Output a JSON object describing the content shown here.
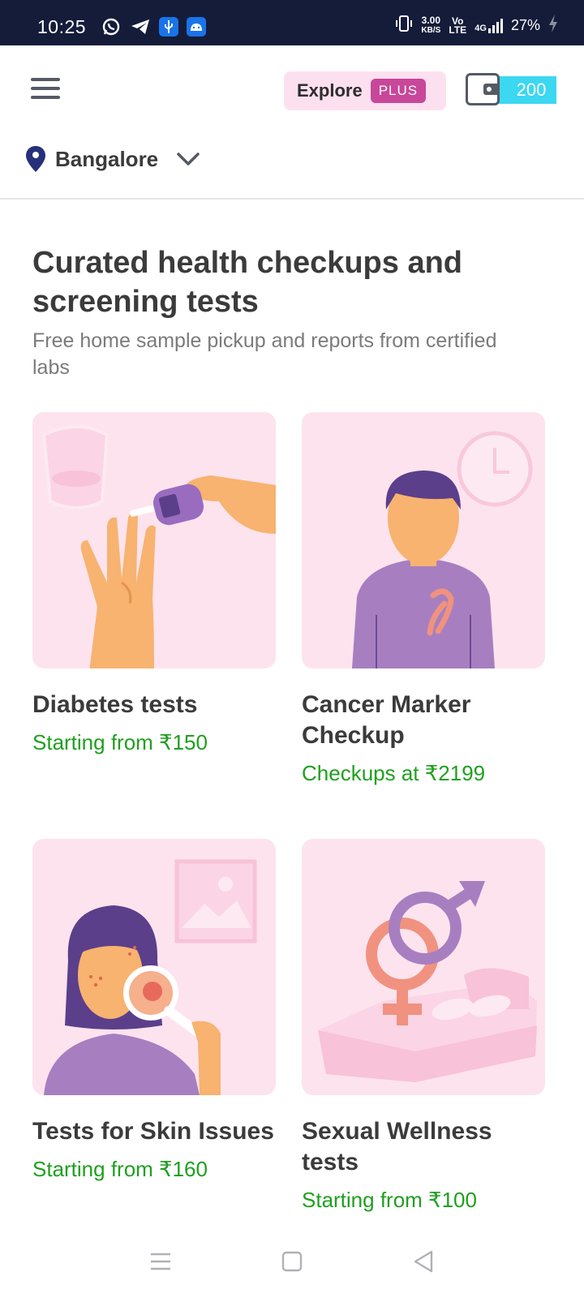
{
  "status_bar": {
    "time": "10:25",
    "net_speed_value": "3.00",
    "net_speed_unit": "KB/S",
    "volte": "Vo LTE",
    "network": "4G",
    "battery": "27%"
  },
  "header": {
    "explore_label": "Explore",
    "plus_badge": "PLUS",
    "wallet_balance": "200",
    "location": "Bangalore"
  },
  "main": {
    "title": "Curated health checkups and screening tests",
    "subtitle": "Free home sample pickup and reports from certified labs",
    "cards": [
      {
        "title": "Diabetes tests",
        "price": "Starting from ₹150"
      },
      {
        "title": "Cancer Marker Checkup",
        "price": "Checkups at ₹2199"
      },
      {
        "title": "Tests for Skin Issues",
        "price": "Starting from ₹160"
      },
      {
        "title": "Sexual Wellness tests",
        "price": "Starting from ₹100"
      }
    ]
  },
  "colors": {
    "status_bar_bg": "#141c3a",
    "card_bg": "#fde3ee",
    "price_green": "#1fa01f",
    "plus_pink": "#c8479a",
    "wallet_cyan": "#3cd7f0",
    "pin_navy": "#28307a"
  }
}
